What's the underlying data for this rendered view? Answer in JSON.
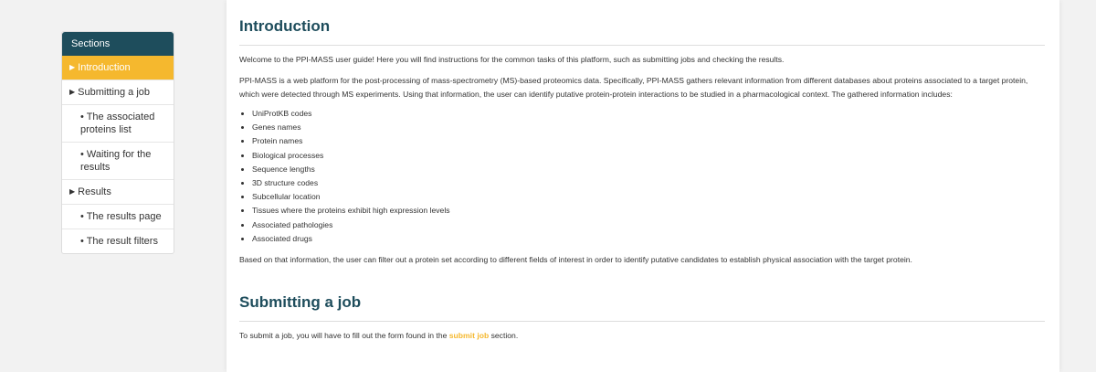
{
  "sidebar": {
    "title": "Sections",
    "items": [
      {
        "label": "Introduction"
      },
      {
        "label": "Submitting a job"
      },
      {
        "label": "• The associated proteins list"
      },
      {
        "label": "• Waiting for the results"
      },
      {
        "label": "Results"
      },
      {
        "label": "• The results page"
      },
      {
        "label": "• The result filters"
      }
    ]
  },
  "main": {
    "intro_title": "Introduction",
    "intro_p1": "Welcome to the PPI-MASS user guide! Here you will find instructions for the common tasks of this platform, such as submitting jobs and checking the results.",
    "intro_p2": "PPI-MASS is a web platform for the post-processing of mass-spectrometry (MS)-based proteomics data. Specifically, PPI-MASS gathers relevant information from different databases about proteins associated to a target protein, which were detected through MS experiments. Using that information, the user can identify putative protein-protein interactions to be studied in a pharmacological context. The gathered information includes:",
    "info_list": [
      "UniProtKB codes",
      "Genes names",
      "Protein names",
      "Biological processes",
      "Sequence lengths",
      "3D structure codes",
      "Subcellular location",
      "Tissues where the proteins exhibit high expression levels",
      "Associated pathologies",
      "Associated drugs"
    ],
    "intro_p3": "Based on that information, the user can filter out a protein set according to different fields of interest in order to identify putative candidates to establish physical association with the target protein.",
    "submit_title": "Submitting a job",
    "submit_p_before": "To submit a job, you will have to fill out the form found in the ",
    "submit_link": "submit job",
    "submit_p_after": " section."
  },
  "colors": {
    "accent": "#f5b82e",
    "header": "#1e4d5c"
  }
}
